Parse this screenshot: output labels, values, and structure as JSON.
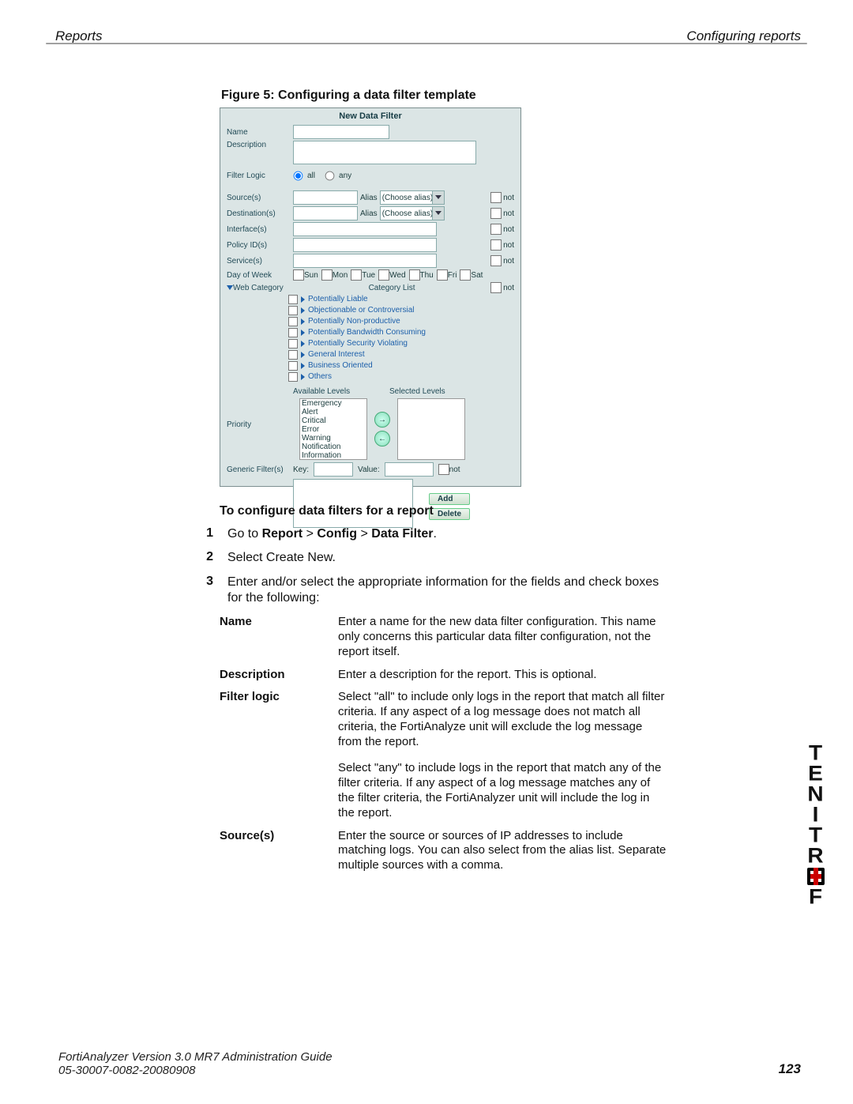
{
  "header": {
    "left": "Reports",
    "right": "Configuring reports"
  },
  "figure_caption": "Figure 5:   Configuring a data filter template",
  "dialog": {
    "title": "New Data Filter",
    "name_label": "Name",
    "name_value": "",
    "desc_label": "Description",
    "desc_value": "",
    "filter_logic_label": "Filter Logic",
    "radio_all": "all",
    "radio_any": "any",
    "rows": [
      {
        "label": "Source(s)",
        "value": "",
        "alias": true,
        "not": true
      },
      {
        "label": "Destination(s)",
        "value": "",
        "alias": true,
        "not": true
      },
      {
        "label": "Interface(s)",
        "value": "",
        "alias": false,
        "not": true
      },
      {
        "label": "Policy ID(s)",
        "value": "",
        "alias": false,
        "not": true
      },
      {
        "label": "Service(s)",
        "value": "",
        "alias": false,
        "not": true
      }
    ],
    "alias_label": "Alias",
    "alias_placeholder": "(Choose alias)",
    "not_label": "not",
    "dow_label": "Day of Week",
    "dow": [
      "Sun",
      "Mon",
      "Tue",
      "Wed",
      "Thu",
      "Fri",
      "Sat"
    ],
    "webcat_label": "Web Category",
    "category_list_label": "Category List",
    "categories": [
      "Potentially Liable",
      "Objectionable or Controversial",
      "Potentially Non-productive",
      "Potentially Bandwidth Consuming",
      "Potentially Security Violating",
      "General Interest",
      "Business Oriented",
      "Others"
    ],
    "priority_label": "Priority",
    "available_levels_label": "Available Levels",
    "selected_levels_label": "Selected Levels",
    "priority_levels": [
      "Emergency",
      "Alert",
      "Critical",
      "Error",
      "Warning",
      "Notification",
      "Information"
    ],
    "generic_label": "Generic Filter(s)",
    "key_label": "Key:",
    "value_label": "Value:",
    "add_btn": "Add",
    "delete_btn": "Delete"
  },
  "section_title": "To configure data filters for a report",
  "steps": [
    "Go to Report > Config > Data Filter.",
    "Select Create New.",
    "Enter and/or select the appropriate information for the fields and check boxes for the following:"
  ],
  "step1_parts": {
    "pre": "Go to ",
    "b1": "Report",
    "sep": " > ",
    "b2": "Config",
    "b3": "Data Filter",
    "end": "."
  },
  "definitions": [
    {
      "k": "Name",
      "v": "Enter a name for the new data filter configuration. This name only concerns this particular data filter configuration, not the report itself."
    },
    {
      "k": "Description",
      "v": "Enter a description for the report. This is optional."
    },
    {
      "k": "Filter logic",
      "v": "Select \"all\" to include only logs in the report that match all filter criteria. If any aspect of a log message does not match all criteria, the FortiAnalyze unit will exclude the log message from the report.\n\nSelect \"any\" to include logs in the report that match any of the filter criteria. If any aspect of a log message matches any of the filter criteria, the FortiAnalyzer unit will include the log in the report."
    },
    {
      "k": "Source(s)",
      "v": "Enter the source or sources of IP addresses to include matching logs. You can also select from the alias list. Separate multiple sources with a comma."
    }
  ],
  "footer": {
    "line1": "FortiAnalyzer Version 3.0 MR7 Administration Guide",
    "line2": "05-30007-0082-20080908"
  },
  "page_number": "123",
  "brand_letters": [
    "T",
    "E",
    "N",
    "I",
    "T",
    "R",
    "F"
  ]
}
